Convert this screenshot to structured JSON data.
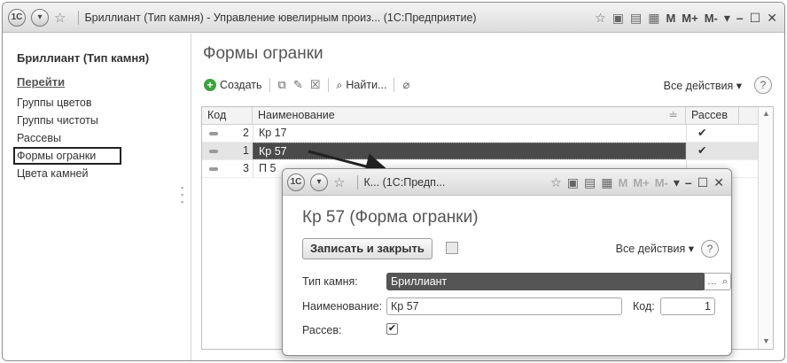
{
  "window": {
    "logo": "1С",
    "title": "Бриллиант (Тип камня) - Управление ювелирным произ...  (1С:Предприятие)",
    "m_buttons": [
      "M",
      "M+",
      "M-"
    ]
  },
  "sidebar": {
    "title": "Бриллиант (Тип камня)",
    "goto_label": "Перейти",
    "items": [
      {
        "label": "Группы цветов"
      },
      {
        "label": "Группы чистоты"
      },
      {
        "label": "Рассевы"
      },
      {
        "label": "Формы огранки"
      },
      {
        "label": "Цвета камней"
      }
    ]
  },
  "main": {
    "title": "Формы огранки",
    "toolbar": {
      "create_label": "Создать",
      "find_label": "Найти...",
      "all_actions_label": "Все действия ▾",
      "help_label": "?"
    },
    "table": {
      "headers": {
        "code": "Код",
        "name": "Наименование",
        "ras": "Рассев"
      },
      "rows": [
        {
          "code": "2",
          "name": "Кр 17",
          "ras": "✔"
        },
        {
          "code": "1",
          "name": "Кр 57",
          "ras": "✔"
        },
        {
          "code": "3",
          "name": "П 5",
          "ras": ""
        }
      ]
    }
  },
  "dialog": {
    "window_title": "К...  (1С:Предп...",
    "title": "Кр 57 (Форма огранки)",
    "save_close_label": "Записать и закрыть",
    "all_actions_label": "Все действия ▾",
    "help_label": "?",
    "fields": {
      "stone_type_label": "Тип камня:",
      "stone_type_value": "Бриллиант",
      "name_label": "Наименование:",
      "name_value": "Кр 57",
      "code_label": "Код:",
      "code_value": "1",
      "ras_label": "Рассев:",
      "ras_checked": "✔"
    }
  }
}
